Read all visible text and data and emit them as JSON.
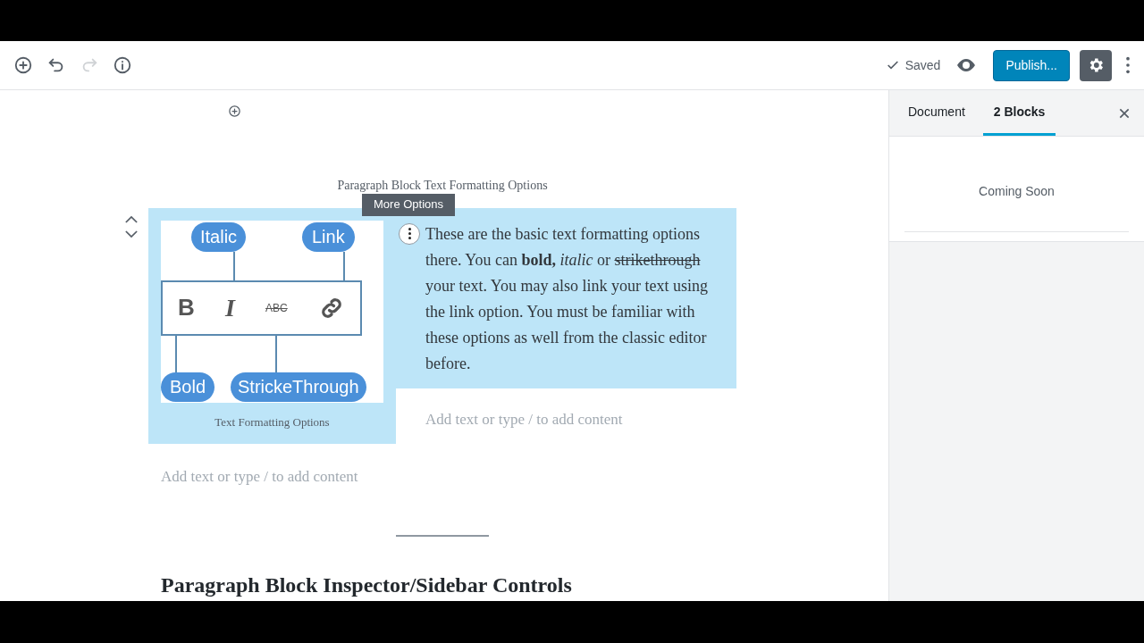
{
  "toolbar": {
    "redo_disabled": true,
    "saved_label": "Saved",
    "publish_label": "Publish...",
    "settings_active": true
  },
  "editor": {
    "heading": "Paragraph Block Text Formatting Options",
    "blocks_selected": true,
    "image": {
      "callouts_top": [
        "Italic",
        "Link"
      ],
      "glyphs": [
        "B",
        "I",
        "ABC"
      ],
      "callouts_bottom": [
        "Bold",
        "StrickeThrough"
      ],
      "caption": "Text Formatting Options"
    },
    "tooltip": "More Options",
    "paragraph": [
      {
        "text": "These are the basic text formatting options there. You can ",
        "kind": "plain"
      },
      {
        "text": "bold, ",
        "kind": "bold"
      },
      {
        "text": "italic",
        "kind": "italic"
      },
      {
        "text": " or ",
        "kind": "plain"
      },
      {
        "text": "strikethrough",
        "kind": "strike"
      },
      {
        "text": " your text. You may also link your text using the link option. You must be familiar with these options as well from the classic editor before.",
        "kind": "plain"
      }
    ],
    "placeholders": [
      "Add text or type / to add content",
      "Add text or type / to add content"
    ],
    "next_heading": "Paragraph Block Inspector/Sidebar Controls"
  },
  "sidebar": {
    "tabs": [
      {
        "label": "Document",
        "selected": false
      },
      {
        "label": "2 Blocks",
        "selected": true
      }
    ],
    "message": "Coming Soon"
  }
}
